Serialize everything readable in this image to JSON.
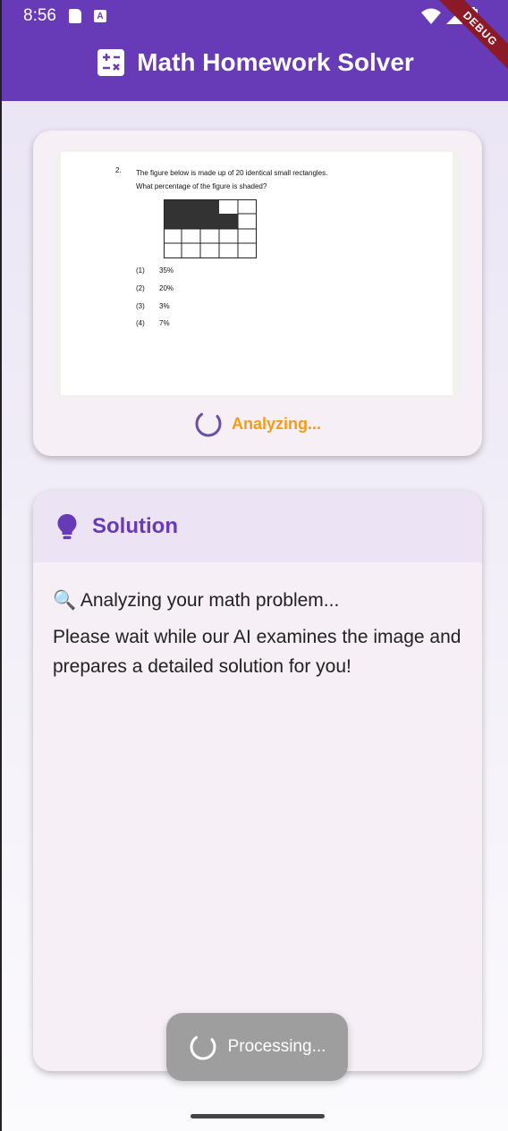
{
  "status_bar": {
    "time": "8:56",
    "a_badge": "A",
    "debug_label": "DEBUG"
  },
  "app_bar": {
    "title": "Math Homework Solver",
    "icon": "calculator-icon",
    "color": "#673ab7"
  },
  "image_card": {
    "worksheet": {
      "question_number": "2.",
      "question_line1": "The figure below is made up of 20 identical small rectangles.",
      "question_line2": "What percentage of the figure is shaded?",
      "options": [
        {
          "num": "(1)",
          "value": "35%"
        },
        {
          "num": "(2)",
          "value": "20%"
        },
        {
          "num": "(3)",
          "value": "3%"
        },
        {
          "num": "(4)",
          "value": "7%"
        }
      ]
    },
    "status_text": "Analyzing...",
    "status_color": "#f59c12"
  },
  "solution_card": {
    "title": "Solution",
    "icon": "lightbulb-icon",
    "line1": "🔍 Analyzing your math problem...",
    "line2": "Please wait while our AI examines the image and prepares a detailed solution for you!"
  },
  "toast": {
    "text": "Processing..."
  }
}
